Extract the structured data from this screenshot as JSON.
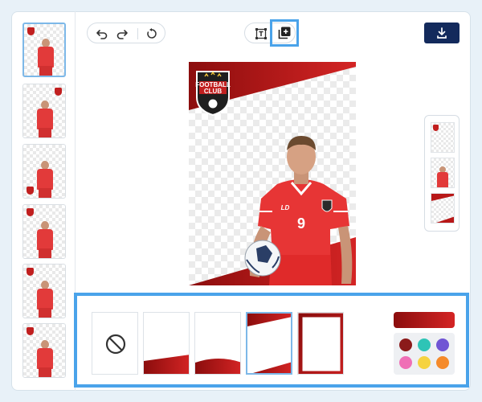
{
  "toolbar": {
    "history_icons": [
      "undo-icon",
      "redo-icon",
      "reset-icon"
    ],
    "tool_icons": [
      "text-frame-icon",
      "add-layer-icon"
    ],
    "download_icon": "download-icon"
  },
  "canvas": {
    "crest": {
      "line1": "FOOTBALL",
      "line2": "CLUB"
    },
    "jersey_number": "9",
    "jersey_mark": "LD"
  },
  "templates": {
    "count": 6,
    "selected_index": 0
  },
  "frames": {
    "options": [
      "none",
      "bottom-band",
      "bottom-wave",
      "top-diagonal",
      "border"
    ],
    "selected": "top-diagonal"
  },
  "colors": {
    "gradient": [
      "#8b0d0d",
      "#d42424"
    ],
    "swatches": [
      "#8b1a1a",
      "#2ec4b6",
      "#7055d4",
      "#ef6fb6",
      "#f5d340",
      "#f58a2a"
    ],
    "highlight": "#4aa3ea",
    "download_button": "#132a5c"
  }
}
